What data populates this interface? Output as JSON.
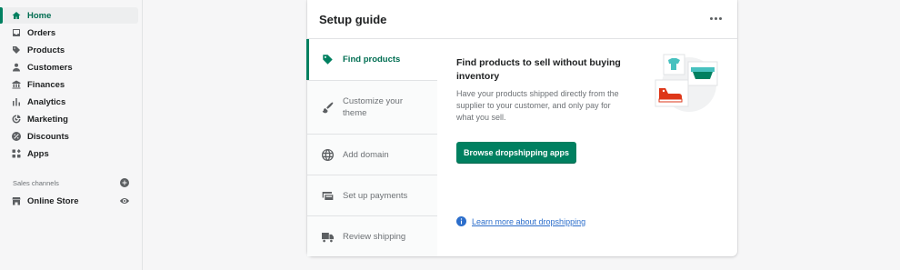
{
  "sidebar": {
    "items": [
      {
        "label": "Home",
        "icon": "home-icon",
        "active": true
      },
      {
        "label": "Orders",
        "icon": "orders-icon"
      },
      {
        "label": "Products",
        "icon": "tag-icon"
      },
      {
        "label": "Customers",
        "icon": "person-icon"
      },
      {
        "label": "Finances",
        "icon": "bank-icon"
      },
      {
        "label": "Analytics",
        "icon": "analytics-icon"
      },
      {
        "label": "Marketing",
        "icon": "marketing-icon"
      },
      {
        "label": "Discounts",
        "icon": "discount-icon"
      },
      {
        "label": "Apps",
        "icon": "apps-icon"
      }
    ],
    "sales_channels_title": "Sales channels",
    "online_store": "Online Store"
  },
  "setup_guide": {
    "title": "Setup guide",
    "steps": [
      {
        "label": "Find products",
        "icon": "tag-icon",
        "active": true
      },
      {
        "label": "Customize your theme",
        "icon": "brush-icon"
      },
      {
        "label": "Add domain",
        "icon": "globe-icon"
      },
      {
        "label": "Set up payments",
        "icon": "credit-card-icon"
      },
      {
        "label": "Review shipping",
        "icon": "truck-icon"
      }
    ],
    "content": {
      "title": "Find products to sell without buying inventory",
      "description": "Have your products shipped directly from the supplier to your customer, and only pay for what you sell.",
      "button": "Browse dropshipping apps",
      "learn_more": "Learn more about dropshipping"
    }
  },
  "colors": {
    "accent": "#008060",
    "link": "#2c6ecb"
  }
}
